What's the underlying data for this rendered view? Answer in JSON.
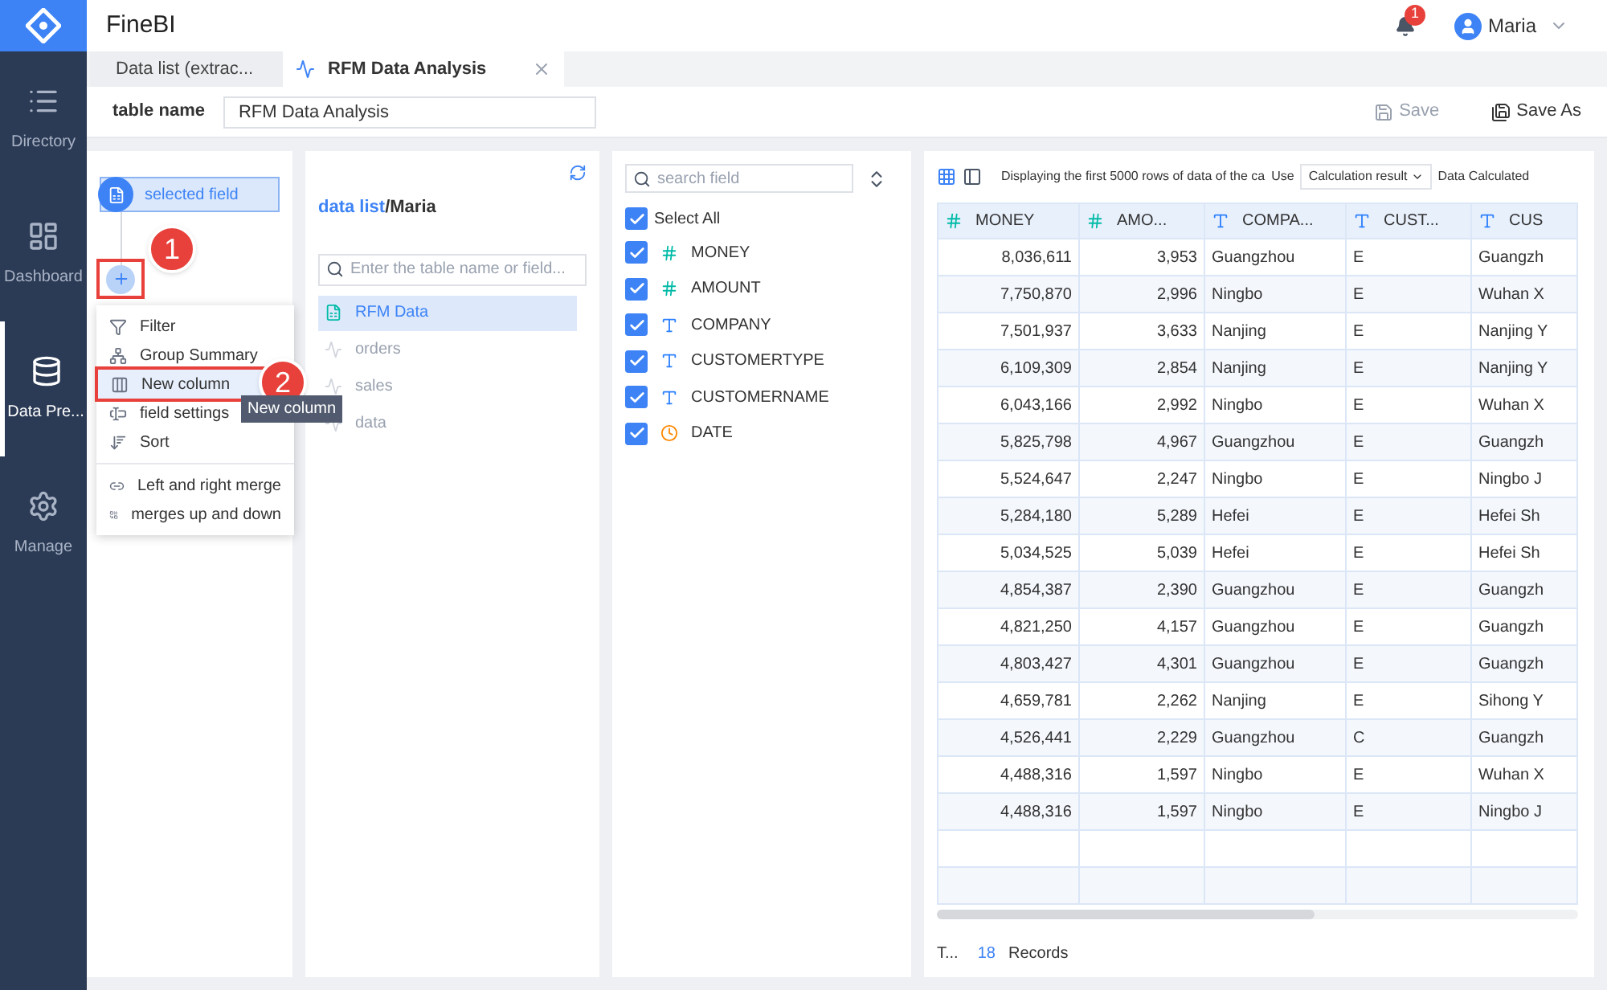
{
  "app": {
    "title": "FineBI",
    "notifications": "1",
    "user": "Maria"
  },
  "sidebar": [
    {
      "label": "Directory",
      "kind": "list",
      "selected": false
    },
    {
      "label": "Dashboard",
      "kind": "dashboard",
      "selected": false
    },
    {
      "label": "Data Pre...",
      "kind": "data",
      "selected": true
    },
    {
      "label": "Manage",
      "kind": "manage",
      "selected": false
    }
  ],
  "tabs": [
    {
      "label": "Data list (extrac...",
      "kind": "home",
      "selected": false
    },
    {
      "label": "RFM Data Analysis",
      "kind": "analysis",
      "selected": true
    }
  ],
  "table_name": {
    "label": "table name",
    "value": "RFM Data Analysis"
  },
  "actions": [
    {
      "label": "Save",
      "kind": "save",
      "disabled": true
    },
    {
      "label": "Save As",
      "kind": "saveas",
      "disabled": false
    }
  ],
  "steps": {
    "selected_field": "selected field",
    "add_marker": "1",
    "add_highlighted": true,
    "menu": [
      [
        {
          "label": "Filter",
          "kind": "filter",
          "highlighted": false
        },
        {
          "label": "Group Summary",
          "kind": "group",
          "highlighted": false
        },
        {
          "label": "New column",
          "kind": "column",
          "highlighted": true,
          "marker": "2",
          "tooltip": "New column"
        },
        {
          "label": "field settings",
          "kind": "settings",
          "highlighted": false
        },
        {
          "label": "Sort",
          "kind": "sort",
          "highlighted": false
        }
      ],
      [
        {
          "label": "Left and right merge",
          "kind": "lrmerge",
          "highlighted": false
        },
        {
          "label": "merges up and down",
          "kind": "udmerge",
          "highlighted": false
        }
      ]
    ]
  },
  "data_list": {
    "title_link": "data list",
    "separator": "/",
    "title_user": "Maria",
    "search_placeholder": "Enter the table name or field...",
    "items": [
      {
        "label": "RFM Data",
        "kind": "xls",
        "selected": true
      },
      {
        "label": "orders",
        "kind": "analysis",
        "selected": false
      },
      {
        "label": "sales",
        "kind": "analysis",
        "selected": false
      },
      {
        "label": "data",
        "kind": "analysis",
        "selected": false
      }
    ]
  },
  "fields": {
    "search_placeholder": "search field",
    "select_all": {
      "label": "Select All",
      "checked": true
    },
    "items": [
      {
        "name": "MONEY",
        "kind": "number",
        "checked": true
      },
      {
        "name": "AMOUNT",
        "kind": "number",
        "checked": true
      },
      {
        "name": "COMPANY",
        "kind": "text",
        "checked": true
      },
      {
        "name": "CUSTOMERTYPE",
        "kind": "text",
        "checked": true
      },
      {
        "name": "CUSTOMERNAME",
        "kind": "text",
        "checked": true
      },
      {
        "name": "DATE",
        "kind": "date",
        "checked": true
      }
    ]
  },
  "table": {
    "info": "Displaying the first 5000 rows of data of the ca",
    "use_label": "Use",
    "mode": "Calculation result",
    "calc_label": "Data Calculated",
    "columns": [
      {
        "label": "MONEY",
        "kind": "number"
      },
      {
        "label": "AMO...",
        "kind": "number"
      },
      {
        "label": "COMPA...",
        "kind": "text"
      },
      {
        "label": "CUST...",
        "kind": "text"
      },
      {
        "label": "CUS",
        "kind": "text"
      }
    ],
    "rows": [
      [
        "8,036,611",
        "3,953",
        "Guangzhou",
        "E",
        "Guangzh"
      ],
      [
        "7,750,870",
        "2,996",
        "Ningbo",
        "E",
        "Wuhan X"
      ],
      [
        "7,501,937",
        "3,633",
        "Nanjing",
        "E",
        "Nanjing Y"
      ],
      [
        "6,109,309",
        "2,854",
        "Nanjing",
        "E",
        "Nanjing Y"
      ],
      [
        "6,043,166",
        "2,992",
        "Ningbo",
        "E",
        "Wuhan X"
      ],
      [
        "5,825,798",
        "4,967",
        "Guangzhou",
        "E",
        "Guangzh"
      ],
      [
        "5,524,647",
        "2,247",
        "Ningbo",
        "E",
        "Ningbo J"
      ],
      [
        "5,284,180",
        "5,289",
        "Hefei",
        "E",
        "Hefei Sh"
      ],
      [
        "5,034,525",
        "5,039",
        "Hefei",
        "E",
        "Hefei Sh"
      ],
      [
        "4,854,387",
        "2,390",
        "Guangzhou",
        "E",
        "Guangzh"
      ],
      [
        "4,821,250",
        "4,157",
        "Guangzhou",
        "E",
        "Guangzh"
      ],
      [
        "4,803,427",
        "4,301",
        "Guangzhou",
        "E",
        "Guangzh"
      ],
      [
        "4,659,781",
        "2,262",
        "Nanjing",
        "E",
        "Sihong Y"
      ],
      [
        "4,526,441",
        "2,229",
        "Guangzhou",
        "C",
        "Guangzh"
      ],
      [
        "4,488,316",
        "1,597",
        "Ningbo",
        "E",
        "Wuhan X"
      ],
      [
        "4,488,316",
        "1,597",
        "Ningbo",
        "E",
        "Ningbo J"
      ]
    ],
    "footer": {
      "prefix": "T...",
      "count": "18",
      "label": "Records"
    }
  }
}
